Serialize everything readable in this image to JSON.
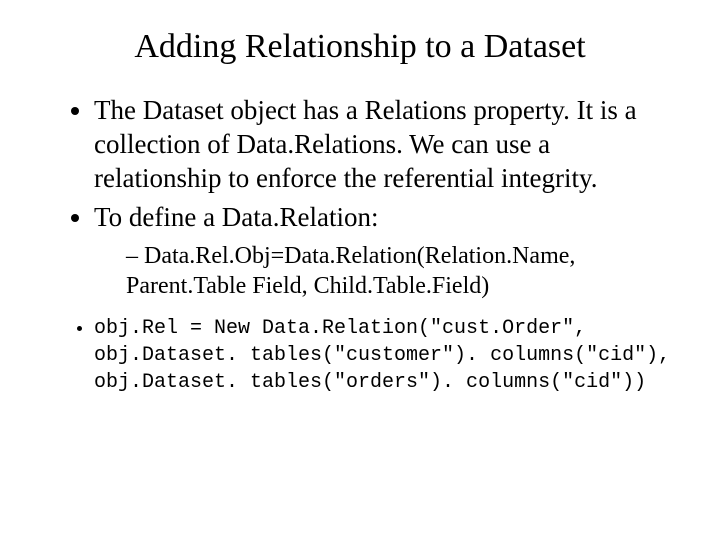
{
  "title": "Adding Relationship to a Dataset",
  "bullets": {
    "b1": "The Dataset object has a Relations property. It is a collection of Data.Relations.  We can use a relationship to enforce the referential integrity.",
    "b2": "To define a Data.Relation:",
    "b2_sub1": "Data.Rel.Obj=Data.Relation(Relation.Name, Parent.Table Field, Child.Table.Field)",
    "code": "obj.Rel = New Data.Relation(\"cust.Order\", obj.Dataset. tables(\"customer\"). columns(\"cid\"), obj.Dataset. tables(\"orders\"). columns(\"cid\"))"
  }
}
